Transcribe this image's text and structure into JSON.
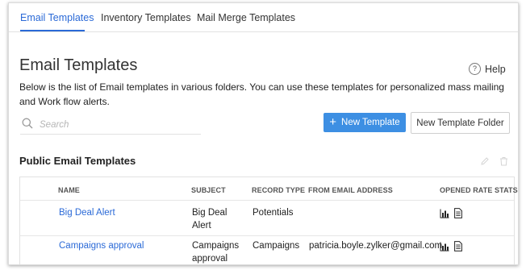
{
  "tabs": [
    {
      "label": "Email Templates",
      "active": true
    },
    {
      "label": "Inventory Templates",
      "active": false
    },
    {
      "label": "Mail Merge Templates",
      "active": false
    }
  ],
  "page": {
    "title": "Email Templates",
    "help_label": "Help",
    "description": "Below is the list of Email templates in various folders. You can use these templates for personalized mass mailing and Work flow alerts."
  },
  "search": {
    "placeholder": "Search",
    "value": ""
  },
  "buttons": {
    "new_template": "New Template",
    "new_folder": "New Template Folder"
  },
  "section": {
    "title": "Public Email Templates"
  },
  "table": {
    "columns": [
      "NAME",
      "SUBJECT",
      "RECORD TYPE",
      "FROM EMAIL ADDRESS",
      "OPENED RATE STATS"
    ],
    "rows": [
      {
        "name": "Big Deal Alert",
        "subject": "Big Deal Alert",
        "record_type": "Potentials",
        "from_email": ""
      },
      {
        "name": "Campaigns approval",
        "subject": "Campaigns approval",
        "record_type": "Campaigns",
        "from_email": "patricia.boyle.zylker@gmail.com"
      }
    ]
  },
  "colors": {
    "accent": "#2b6ad7",
    "primary_button": "#3d8fe3"
  },
  "icons": {
    "help": "help-circle-icon",
    "search": "search-icon",
    "edit": "pencil-icon",
    "delete": "trash-icon",
    "stats": "bar-chart-icon",
    "report": "document-icon"
  }
}
